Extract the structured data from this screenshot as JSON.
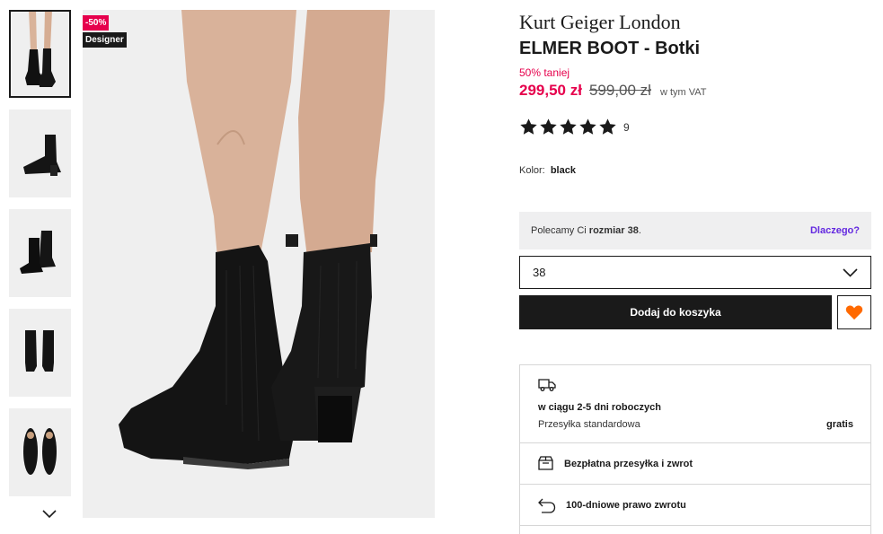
{
  "badges": {
    "discount": "-50%",
    "designer": "Designer"
  },
  "gallery": {
    "thumbnails": [
      {
        "view": "worn-front",
        "active": true
      },
      {
        "view": "side"
      },
      {
        "view": "pair-angle"
      },
      {
        "view": "back-pair"
      },
      {
        "view": "top-pair"
      }
    ],
    "next_icon": "chevron-down-icon"
  },
  "product": {
    "brand": "Kurt Geiger London",
    "title": "ELMER BOOT - Botki",
    "discount_text": "50% taniej",
    "price_now": "299,50 zł",
    "price_old": "599,00 zł",
    "vat_note": "w tym VAT",
    "rating": 5,
    "rating_count": "9",
    "color_label": "Kolor:",
    "color_value": "black"
  },
  "size": {
    "recommend_prefix": "Polecamy Ci ",
    "recommend_size": "rozmiar 38",
    "recommend_suffix": ".",
    "why_link": "Dlaczego?",
    "selected": "38"
  },
  "actions": {
    "add_to_cart": "Dodaj do koszyka",
    "wishlist_icon": "heart-icon",
    "wishlist_color": "#ff6900"
  },
  "shipping": {
    "delivery_title": "w ciągu 2-5 dni roboczych",
    "delivery_type": "Przesyłka standardowa",
    "delivery_price": "gratis",
    "free_shipping": "Bezpłatna przesyłka i zwrot",
    "returns": "100-dniowe prawo zwrotu"
  },
  "colors": {
    "accent": "#e6004c",
    "link": "#6328e0",
    "dark": "#1a1a1a"
  }
}
